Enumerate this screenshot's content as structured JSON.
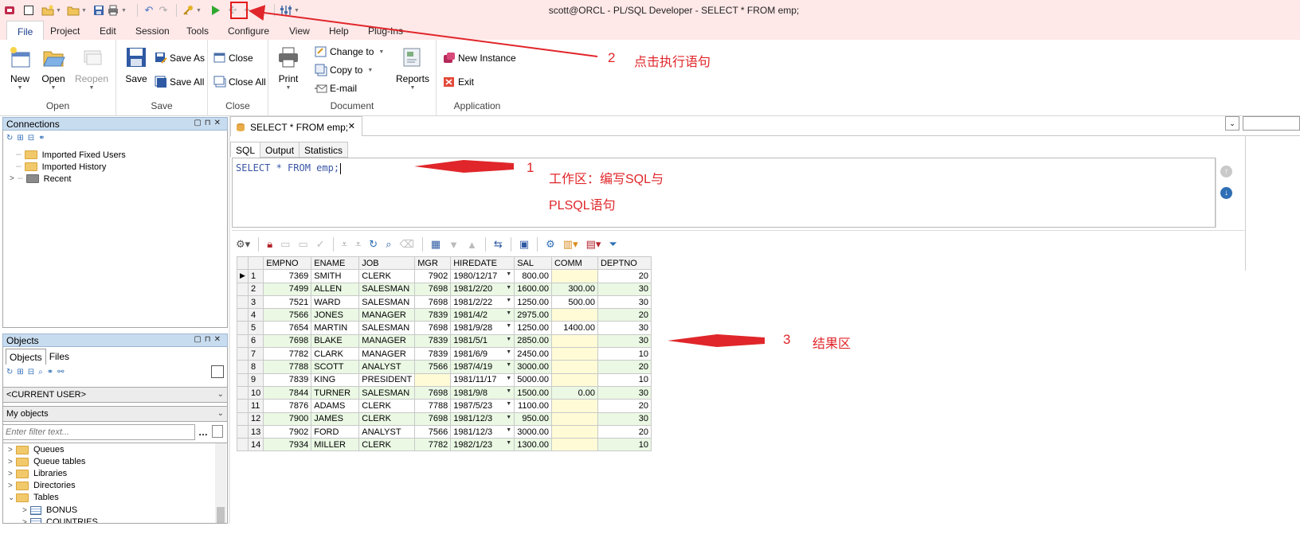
{
  "window": {
    "title": "scott@ORCL - PL/SQL Developer - SELECT * FROM emp;"
  },
  "ribbon_tabs": [
    "File",
    "Project",
    "Edit",
    "Session",
    "Tools",
    "Configure",
    "View",
    "Help",
    "Plug-Ins"
  ],
  "ribbon": {
    "open_group": {
      "label": "Open",
      "new": "New",
      "open": "Open",
      "reopen": "Reopen"
    },
    "save_group": {
      "label": "Save",
      "save": "Save",
      "save_as": "Save As",
      "save_all": "Save All"
    },
    "close_group": {
      "label": "Close",
      "close": "Close",
      "close_all": "Close All"
    },
    "document_group": {
      "label": "Document",
      "print": "Print",
      "change_to": "Change to",
      "copy_to": "Copy to",
      "email": "E-mail",
      "reports": "Reports"
    },
    "application_group": {
      "label": "Application",
      "new_instance": "New Instance",
      "exit": "Exit"
    }
  },
  "connections": {
    "title": "Connections",
    "items": [
      "Imported Fixed Users",
      "Imported History",
      "Recent"
    ]
  },
  "objects": {
    "title": "Objects",
    "tabs": [
      "Objects",
      "Files"
    ],
    "user_select": "<CURRENT USER>",
    "filter_select": "My objects",
    "filter_placeholder": "Enter filter text...",
    "tree": [
      "Queues",
      "Queue tables",
      "Libraries",
      "Directories",
      "Tables",
      "BONUS",
      "COUNTRIES"
    ]
  },
  "editor": {
    "doc_tab": "SELECT * FROM emp;",
    "sub_tabs": [
      "SQL",
      "Output",
      "Statistics"
    ],
    "sql": "SELECT * FROM emp;"
  },
  "grid": {
    "columns": [
      "EMPNO",
      "ENAME",
      "JOB",
      "MGR",
      "HIREDATE",
      "SAL",
      "COMM",
      "DEPTNO"
    ],
    "rows": [
      [
        "1",
        "7369",
        "SMITH",
        "CLERK",
        "7902",
        "1980/12/17",
        "800.00",
        "",
        "20"
      ],
      [
        "2",
        "7499",
        "ALLEN",
        "SALESMAN",
        "7698",
        "1981/2/20",
        "1600.00",
        "300.00",
        "30"
      ],
      [
        "3",
        "7521",
        "WARD",
        "SALESMAN",
        "7698",
        "1981/2/22",
        "1250.00",
        "500.00",
        "30"
      ],
      [
        "4",
        "7566",
        "JONES",
        "MANAGER",
        "7839",
        "1981/4/2",
        "2975.00",
        "",
        "20"
      ],
      [
        "5",
        "7654",
        "MARTIN",
        "SALESMAN",
        "7698",
        "1981/9/28",
        "1250.00",
        "1400.00",
        "30"
      ],
      [
        "6",
        "7698",
        "BLAKE",
        "MANAGER",
        "7839",
        "1981/5/1",
        "2850.00",
        "",
        "30"
      ],
      [
        "7",
        "7782",
        "CLARK",
        "MANAGER",
        "7839",
        "1981/6/9",
        "2450.00",
        "",
        "10"
      ],
      [
        "8",
        "7788",
        "SCOTT",
        "ANALYST",
        "7566",
        "1987/4/19",
        "3000.00",
        "",
        "20"
      ],
      [
        "9",
        "7839",
        "KING",
        "PRESIDENT",
        "",
        "1981/11/17",
        "5000.00",
        "",
        "10"
      ],
      [
        "10",
        "7844",
        "TURNER",
        "SALESMAN",
        "7698",
        "1981/9/8",
        "1500.00",
        "0.00",
        "30"
      ],
      [
        "11",
        "7876",
        "ADAMS",
        "CLERK",
        "7788",
        "1987/5/23",
        "1100.00",
        "",
        "20"
      ],
      [
        "12",
        "7900",
        "JAMES",
        "CLERK",
        "7698",
        "1981/12/3",
        "950.00",
        "",
        "30"
      ],
      [
        "13",
        "7902",
        "FORD",
        "ANALYST",
        "7566",
        "1981/12/3",
        "3000.00",
        "",
        "20"
      ],
      [
        "14",
        "7934",
        "MILLER",
        "CLERK",
        "7782",
        "1982/1/23",
        "1300.00",
        "",
        "10"
      ]
    ]
  },
  "annotations": {
    "a1_num": "1",
    "a1_line1": "工作区：编写SQL与",
    "a1_line2": "PLSQL语句",
    "a2_num": "2",
    "a2_text": "点击执行语句",
    "a3_num": "3",
    "a3_text": "结果区"
  },
  "colors": {
    "annotation": "#e0262a",
    "titlebar": "#ffe8e8",
    "pane_header": "#c8dcef",
    "grid_even_row": "#eaf8e4",
    "grid_null": "#fffbd6"
  }
}
